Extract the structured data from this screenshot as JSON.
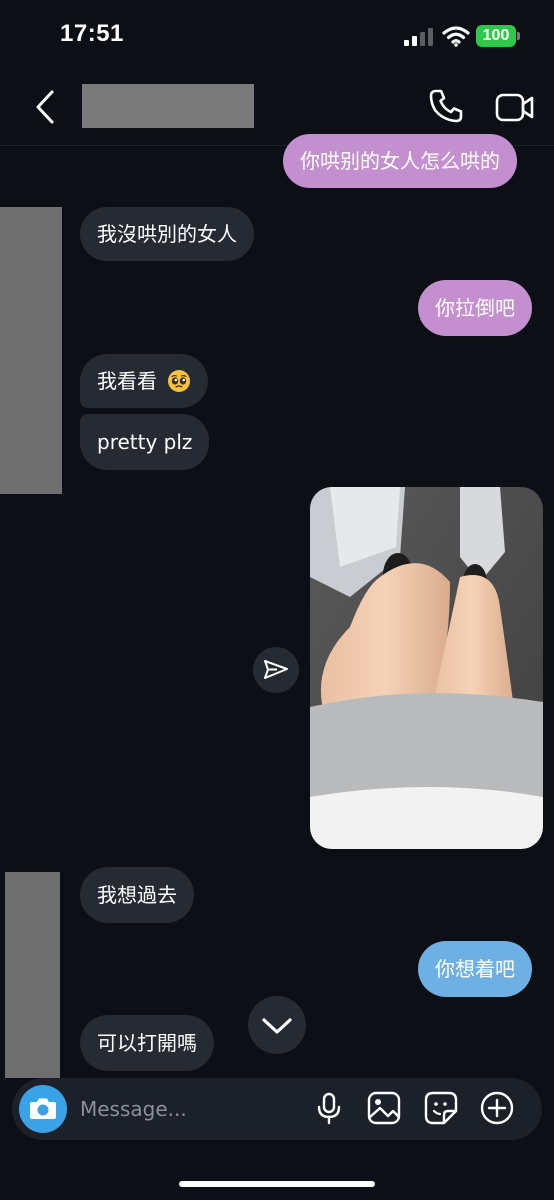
{
  "status_bar": {
    "time": "17:51",
    "battery": "100"
  },
  "messages": [
    {
      "side": "out",
      "text": "你哄别的女人怎么哄的"
    },
    {
      "side": "in",
      "text": "我沒哄別的女人"
    },
    {
      "side": "out",
      "text": "你拉倒吧"
    },
    {
      "side": "in",
      "text": "我看看"
    },
    {
      "side": "in",
      "text": "pretty plz"
    },
    {
      "side": "in",
      "text": "我想過去"
    },
    {
      "side": "out",
      "text": "你想着吧"
    },
    {
      "side": "in",
      "text": "可以打開嗎"
    }
  ],
  "composer": {
    "placeholder": "Message..."
  },
  "colors": {
    "outgoing_pink": "#c48fcf",
    "outgoing_blue": "#6eb0e3",
    "incoming": "#262a33",
    "background": "#0c0f16",
    "camera": "#3aa3e8",
    "battery": "#30c84b"
  },
  "icons": [
    "back-arrow-icon",
    "phone-icon",
    "video-camera-icon",
    "pleading-face-emoji",
    "send-arrow-icon",
    "chevron-down-icon",
    "camera-icon",
    "microphone-icon",
    "gallery-icon",
    "sticker-icon",
    "plus-icon"
  ]
}
